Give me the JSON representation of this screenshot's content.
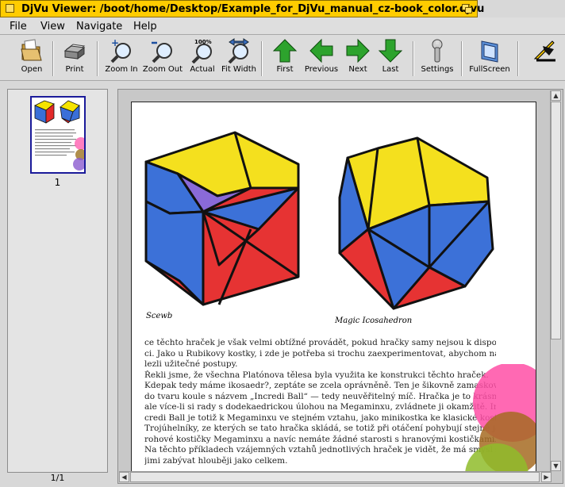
{
  "window": {
    "title": "DjVu Viewer: /boot/home/Desktop/Example_for_DjVu_manual_cz-book_color.djvu"
  },
  "menu": {
    "file": "File",
    "view": "View",
    "navigate": "Navigate",
    "help": "Help"
  },
  "toolbar": {
    "open": "Open",
    "print": "Print",
    "zoom_in": "Zoom In",
    "zoom_out": "Zoom Out",
    "actual": "Actual",
    "actual_badge": "100%",
    "fit_width": "Fit Width",
    "first": "First",
    "previous": "Previous",
    "next": "Next",
    "last": "Last",
    "settings": "Settings",
    "fullscreen": "FullScreen"
  },
  "sidebar": {
    "thumb_label": "1",
    "page_count": "1/1"
  },
  "page": {
    "caption_left": "Scewb",
    "caption_right": "Magic Icosahedron",
    "lines": [
      "ce těchto hraček je však velmi obtížné provádět, pokud hračky samy nejsou k dispozi-",
      "ci. Jako u Rubikovy kostky, i zde je potřeba si trochu zaexperimentovat, abychom na-",
      "lezli užitečné postupy.",
      "    Řekli jsme, že všechna Platónova tělesa byla využita ke konstrukci těchto hraček.",
      "Kdepak tedy máme ikosaedr?, zeptáte se zcela oprávněně. Ten je šikovně zamaskován",
      "do tvaru koule s názvem „Incredi Ball“ — tedy neuvěřitelný míč. Hračka je to krásná,",
      "ale více-li si rady s dodekaedrickou úlohou na Megaminxu, zvládnete ji okamžitě. In-",
      "credi Ball je totiž k Megaminxu ve stejném vztahu, jako minikostka ke klasické kostce.",
      "Trojúhelníky, ze kterých se tato hračka skládá, se totiž při otáčení pohybují stejně jako",
      "rohové kostičky Megaminxu a navíc nemáte žádné starosti s hranovými kostičkami.",
      "Na těchto příkladech vzájemných vztahů jednotlivých hraček je vidět, že má smysl se",
      "jimi zabývat hlouběji jako celkem."
    ]
  }
}
